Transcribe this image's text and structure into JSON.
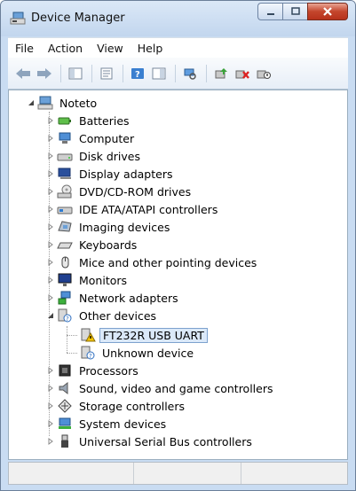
{
  "window": {
    "title": "Device Manager"
  },
  "menu": {
    "items": [
      "File",
      "Action",
      "View",
      "Help"
    ]
  },
  "toolbar": {
    "buttons": [
      "back-icon",
      "forward-icon",
      "show-hide-tree-icon",
      "properties-icon",
      "help-icon",
      "action-pane-icon",
      "scan-hardware-icon",
      "update-driver-icon",
      "uninstall-icon",
      "disable-icon"
    ]
  },
  "tree": {
    "root": "Noteto",
    "categories": [
      {
        "label": "Batteries",
        "icon": "battery-icon",
        "expanded": false
      },
      {
        "label": "Computer",
        "icon": "computer-icon",
        "expanded": false
      },
      {
        "label": "Disk drives",
        "icon": "disk-drive-icon",
        "expanded": false
      },
      {
        "label": "Display adapters",
        "icon": "display-adapter-icon",
        "expanded": false
      },
      {
        "label": "DVD/CD-ROM drives",
        "icon": "dvd-drive-icon",
        "expanded": false
      },
      {
        "label": "IDE ATA/ATAPI controllers",
        "icon": "ide-controller-icon",
        "expanded": false
      },
      {
        "label": "Imaging devices",
        "icon": "camera-icon",
        "expanded": false
      },
      {
        "label": "Keyboards",
        "icon": "keyboard-icon",
        "expanded": false
      },
      {
        "label": "Mice and other pointing devices",
        "icon": "mouse-icon",
        "expanded": false
      },
      {
        "label": "Monitors",
        "icon": "monitor-icon",
        "expanded": false
      },
      {
        "label": "Network adapters",
        "icon": "network-adapter-icon",
        "expanded": false
      },
      {
        "label": "Other devices",
        "icon": "other-device-icon",
        "expanded": true,
        "children": [
          {
            "label": "FT232R USB UART",
            "icon": "warning-device-icon",
            "selected": true
          },
          {
            "label": "Unknown device",
            "icon": "unknown-device-icon",
            "selected": false
          }
        ]
      },
      {
        "label": "Processors",
        "icon": "processor-icon",
        "expanded": false
      },
      {
        "label": "Sound, video and game controllers",
        "icon": "sound-icon",
        "expanded": false
      },
      {
        "label": "Storage controllers",
        "icon": "storage-controller-icon",
        "expanded": false
      },
      {
        "label": "System devices",
        "icon": "system-device-icon",
        "expanded": false
      },
      {
        "label": "Universal Serial Bus controllers",
        "icon": "usb-icon",
        "expanded": false
      }
    ]
  },
  "colors": {
    "selection": "#dbe9f9",
    "selection_border": "#7da2ce",
    "close_button": "#c4452c"
  }
}
